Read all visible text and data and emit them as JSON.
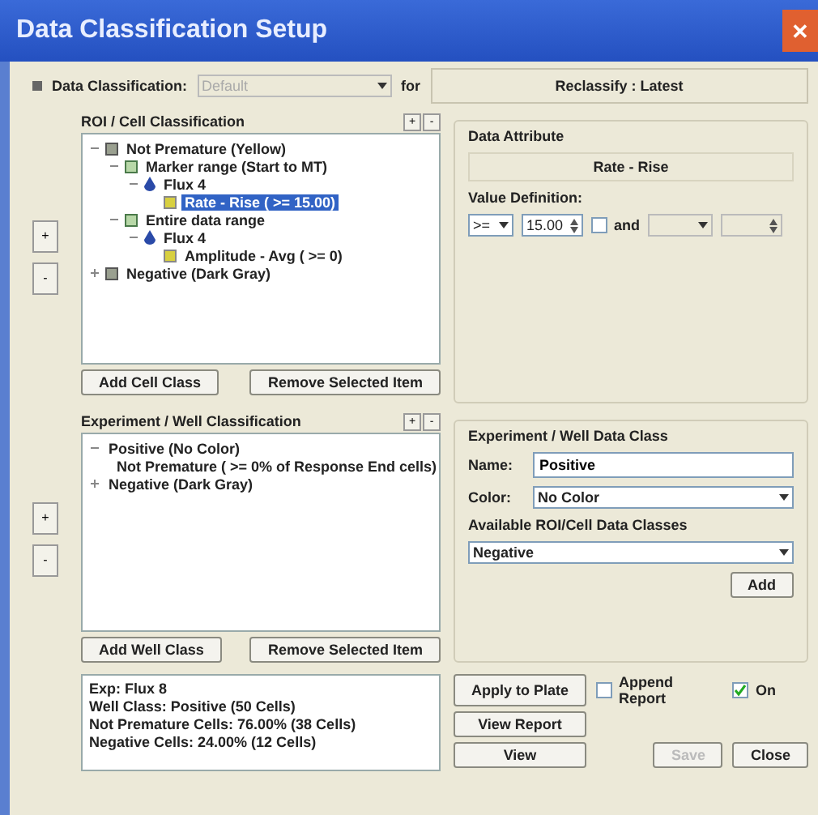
{
  "window": {
    "title": "Data Classification Setup",
    "close": "✕"
  },
  "header": {
    "label": "Data Classification:",
    "dropdown": {
      "value": "Default",
      "disabled": true
    },
    "for_label": "for",
    "target": "Reclassify : Latest"
  },
  "roi_panel": {
    "title": "ROI / Cell Classification",
    "side_buttons": [
      "+",
      "-"
    ],
    "header_buttons": [
      "+",
      "-"
    ],
    "tree": [
      {
        "label": "Not Premature (Yellow)",
        "kind": "class",
        "expanded": true,
        "selected": false,
        "children": [
          {
            "label": "Marker range (Start to MT)",
            "kind": "range",
            "expanded": true,
            "selected": false,
            "children": [
              {
                "label": "Flux 4",
                "kind": "flux",
                "expanded": true,
                "selected": false,
                "children": [
                  {
                    "label": "Rate - Rise ( >= 15.00)",
                    "kind": "attribute",
                    "selected": true
                  }
                ]
              }
            ]
          },
          {
            "label": "Entire data range",
            "kind": "range",
            "expanded": true,
            "selected": false,
            "children": [
              {
                "label": "Flux 4",
                "kind": "flux",
                "expanded": true,
                "selected": false,
                "children": [
                  {
                    "label": "Amplitude - Avg ( >= 0)",
                    "kind": "attribute",
                    "selected": false
                  }
                ]
              }
            ]
          }
        ]
      },
      {
        "label": "Negative (Dark Gray)",
        "kind": "class",
        "expanded": false,
        "selected": false
      }
    ],
    "buttons": [
      "Add Cell Class",
      "Remove Selected Item"
    ]
  },
  "data_attribute": {
    "title": "Data Attribute",
    "name": "Rate - Rise",
    "value_label": "Value Definition:",
    "operator": ">=",
    "value": "15.00",
    "and_label": "and",
    "and_checked": false
  },
  "well_panel": {
    "title": "Experiment / Well Classification",
    "side_buttons": [
      "+",
      "-"
    ],
    "header_buttons": [
      "+",
      "-"
    ],
    "tree": [
      {
        "label": "Positive (No Color)",
        "expanded": true,
        "selected": false,
        "children": [
          {
            "label": "Not Premature ( >= 0% of Response End cells)",
            "selected": false
          }
        ]
      },
      {
        "label": "Negative (Dark Gray)",
        "expanded": false,
        "selected": false
      }
    ],
    "buttons": [
      "Add Well Class",
      "Remove Selected Item"
    ]
  },
  "well_data_class": {
    "title": "Experiment / Well Data Class",
    "name_label": "Name:",
    "name_value": "Positive",
    "color_label": "Color:",
    "color_value": "No Color",
    "available_label": "Available ROI/Cell Data Classes",
    "available_value": "Negative",
    "add_button": "Add"
  },
  "summary": [
    "Exp: Flux 8",
    "Well Class: Positive (50 Cells)",
    "Not Premature Cells: 76.00% (38 Cells)",
    "Negative Cells: 24.00% (12 Cells)"
  ],
  "actions": {
    "apply": "Apply to Plate",
    "append_label": "Append Report",
    "append_checked": false,
    "on_label": "On",
    "on_checked": true,
    "view_report": "View Report",
    "view": "View",
    "save": {
      "label": "Save",
      "disabled": true
    },
    "close": "Close"
  }
}
